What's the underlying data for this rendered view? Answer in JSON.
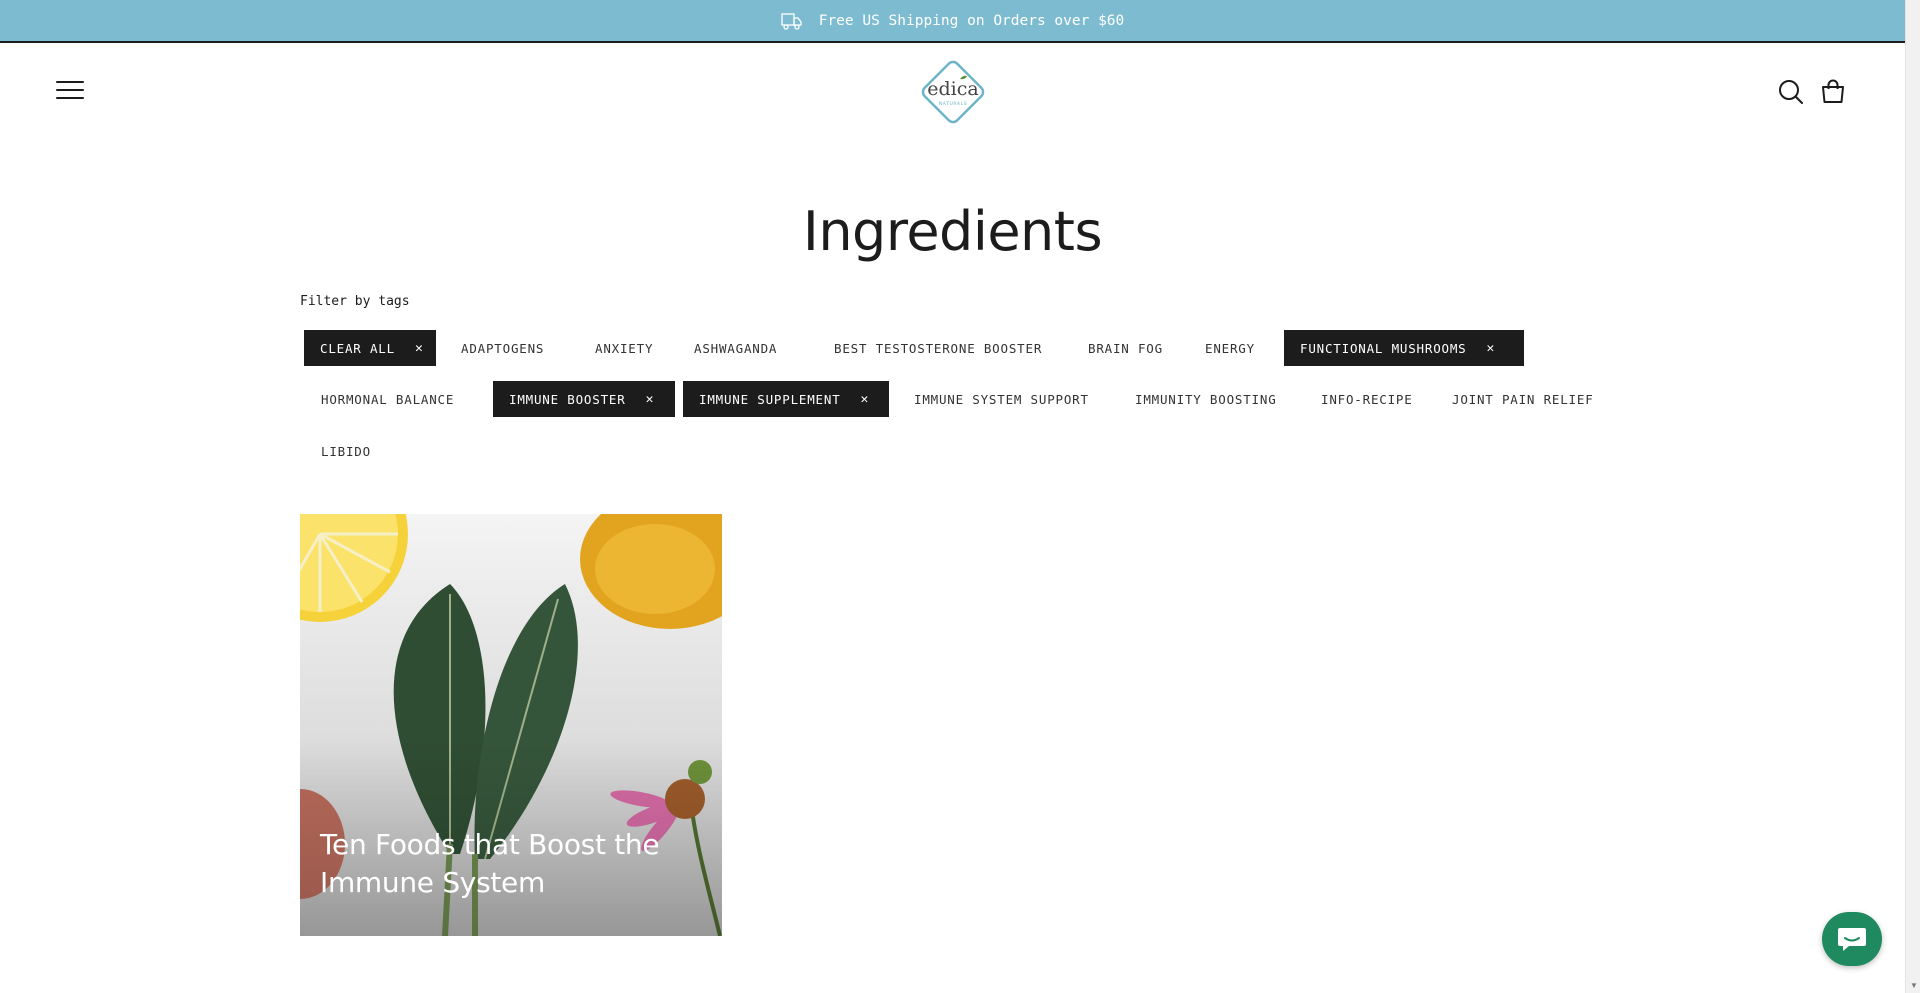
{
  "announcement": {
    "text": "Free US Shipping on Orders over $60",
    "icon": "truck-icon"
  },
  "header": {
    "logo": {
      "brand": "edica",
      "sub": "NATURALS",
      "color": "#6bb4c8",
      "accent": "#5a8f3a"
    },
    "menu_icon": "hamburger-icon",
    "search_icon": "search-icon",
    "cart_icon": "shopping-bag-icon"
  },
  "page": {
    "title": "Ingredients",
    "filter_label": "Filter by tags"
  },
  "tags": [
    {
      "label": "CLEAR ALL",
      "active": true
    },
    {
      "label": "ADAPTOGENS",
      "active": false
    },
    {
      "label": "ANXIETY",
      "active": false
    },
    {
      "label": "ASHWAGANDA",
      "active": false
    },
    {
      "label": "BEST TESTOSTERONE BOOSTER",
      "active": false
    },
    {
      "label": "BRAIN FOG",
      "active": false
    },
    {
      "label": "ENERGY",
      "active": false
    },
    {
      "label": "FUNCTIONAL MUSHROOMS",
      "active": true
    },
    {
      "label": "HORMONAL BALANCE",
      "active": false
    },
    {
      "label": "IMMUNE BOOSTER",
      "active": true
    },
    {
      "label": "IMMUNE SUPPLEMENT",
      "active": true
    },
    {
      "label": "IMMUNE SYSTEM SUPPORT",
      "active": false
    },
    {
      "label": "IMMUNITY BOOSTING",
      "active": false
    },
    {
      "label": "INFO-RECIPE",
      "active": false
    },
    {
      "label": "JOINT PAIN RELIEF",
      "active": false
    },
    {
      "label": "LIBIDO",
      "active": false
    }
  ],
  "remove_glyph": "✕",
  "articles": [
    {
      "title": "Ten Foods that Boost the Immune System",
      "image": "kale-lemon-turmeric-echinacea"
    }
  ],
  "chat": {
    "icon": "chat-bubble-icon",
    "color": "#1f8a5f"
  },
  "colors": {
    "announcement_bg": "#7dbcd0",
    "active_tag_bg": "#1c1c1c",
    "text": "#1c1c1c"
  }
}
